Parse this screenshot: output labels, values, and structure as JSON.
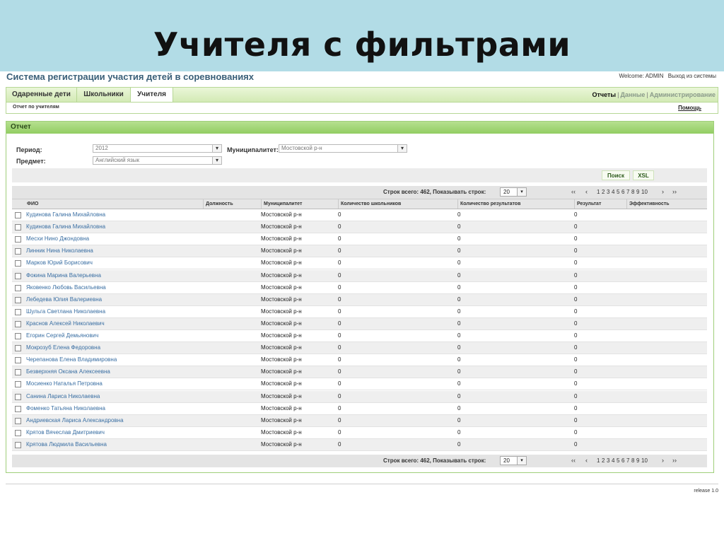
{
  "slide": {
    "title": "Учителя с фильтрами"
  },
  "app": {
    "title": "Система регистрации участия детей в соревнованиях"
  },
  "user": {
    "welcome": "Welcome: ADMIN",
    "logout": "Выход из системы"
  },
  "tabs": [
    {
      "label": "Одаренные дети",
      "active": false
    },
    {
      "label": "Школьники",
      "active": false
    },
    {
      "label": "Учителя",
      "active": true
    }
  ],
  "top_links": {
    "reports": "Отчеты",
    "sep": "|",
    "data": "Данные",
    "admin": "Администрирование"
  },
  "breadcrumb": "Отчет по учителям",
  "help": "Помощь",
  "report": {
    "title": "Отчет",
    "filters": {
      "period_label": "Период:",
      "period_value": "2012",
      "subject_label": "Предмет:",
      "subject_value": "Английский язык",
      "municipality_label": "Муниципалитет:",
      "municipality_value": "Мостовской р-н"
    },
    "buttons": {
      "search": "Поиск",
      "xsl": "XSL"
    },
    "pager": {
      "info": "Строк всего: 462, Показывать строк:",
      "page_size": "20",
      "first": "‹‹",
      "prev": "‹",
      "pages": [
        "1",
        "2",
        "3",
        "4",
        "5",
        "6",
        "7",
        "8",
        "9",
        "10"
      ],
      "next": "›",
      "last": "››"
    },
    "columns": [
      "ФИО",
      "Должность",
      "Муниципалитет",
      "Количество школьников",
      "Количество результатов",
      "Результат",
      "Эффективность"
    ],
    "rows": [
      {
        "name": "Кудинова Галина Михайловна",
        "position": "",
        "municipality": "Мостовской р-н",
        "students": "0",
        "results": "0",
        "result": "0",
        "efficiency": ""
      },
      {
        "name": "Кудинова Галина Михайловна",
        "position": "",
        "municipality": "Мостовской р-н",
        "students": "0",
        "results": "0",
        "result": "0",
        "efficiency": ""
      },
      {
        "name": "Месхи Нино Джондовна",
        "position": "",
        "municipality": "Мостовской р-н",
        "students": "0",
        "results": "0",
        "result": "0",
        "efficiency": ""
      },
      {
        "name": "Линник Нина Николаевна",
        "position": "",
        "municipality": "Мостовской р-н",
        "students": "0",
        "results": "0",
        "result": "0",
        "efficiency": ""
      },
      {
        "name": "Марков Юрий Борисович",
        "position": "",
        "municipality": "Мостовской р-н",
        "students": "0",
        "results": "0",
        "result": "0",
        "efficiency": ""
      },
      {
        "name": "Фокина Марина Валерьевна",
        "position": "",
        "municipality": "Мостовской р-н",
        "students": "0",
        "results": "0",
        "result": "0",
        "efficiency": ""
      },
      {
        "name": "Яковенко Любовь Васильевна",
        "position": "",
        "municipality": "Мостовской р-н",
        "students": "0",
        "results": "0",
        "result": "0",
        "efficiency": ""
      },
      {
        "name": "Лебедева Юлия Валериевна",
        "position": "",
        "municipality": "Мостовской р-н",
        "students": "0",
        "results": "0",
        "result": "0",
        "efficiency": ""
      },
      {
        "name": "Шульга Светлана Николаевна",
        "position": "",
        "municipality": "Мостовской р-н",
        "students": "0",
        "results": "0",
        "result": "0",
        "efficiency": ""
      },
      {
        "name": "Краснов Алексей Николаевич",
        "position": "",
        "municipality": "Мостовской р-н",
        "students": "0",
        "results": "0",
        "result": "0",
        "efficiency": ""
      },
      {
        "name": "Егорин Сергей Демьянович",
        "position": "",
        "municipality": "Мостовской р-н",
        "students": "0",
        "results": "0",
        "result": "0",
        "efficiency": ""
      },
      {
        "name": "Мокрозуб Елена Федоровна",
        "position": "",
        "municipality": "Мостовской р-н",
        "students": "0",
        "results": "0",
        "result": "0",
        "efficiency": ""
      },
      {
        "name": "Черепанова Елена Владимировна",
        "position": "",
        "municipality": "Мостовской р-н",
        "students": "0",
        "results": "0",
        "result": "0",
        "efficiency": ""
      },
      {
        "name": "Безверхняя Оксана Алексеевна",
        "position": "",
        "municipality": "Мостовской р-н",
        "students": "0",
        "results": "0",
        "result": "0",
        "efficiency": ""
      },
      {
        "name": "Мосиенко Наталья Петровна",
        "position": "",
        "municipality": "Мостовской р-н",
        "students": "0",
        "results": "0",
        "result": "0",
        "efficiency": ""
      },
      {
        "name": "Санина Лариса Николаевна",
        "position": "",
        "municipality": "Мостовской р-н",
        "students": "0",
        "results": "0",
        "result": "0",
        "efficiency": ""
      },
      {
        "name": "Фоменко Татьяна Николаевна",
        "position": "",
        "municipality": "Мостовской р-н",
        "students": "0",
        "results": "0",
        "result": "0",
        "efficiency": ""
      },
      {
        "name": "Андриевская Лариса Александровна",
        "position": "",
        "municipality": "Мостовской р-н",
        "students": "0",
        "results": "0",
        "result": "0",
        "efficiency": ""
      },
      {
        "name": "Крятов Вячеслав Дмитриевич",
        "position": "",
        "municipality": "Мостовской р-н",
        "students": "0",
        "results": "0",
        "result": "0",
        "efficiency": ""
      },
      {
        "name": "Крятова Людмила Васильевна",
        "position": "",
        "municipality": "Мостовской р-н",
        "students": "0",
        "results": "0",
        "result": "0",
        "efficiency": ""
      }
    ]
  },
  "release": "release 1.0",
  "colors": {
    "banner": "#b2dce6",
    "accent_green": "#92cd62",
    "link_blue": "#3a6fa3"
  }
}
